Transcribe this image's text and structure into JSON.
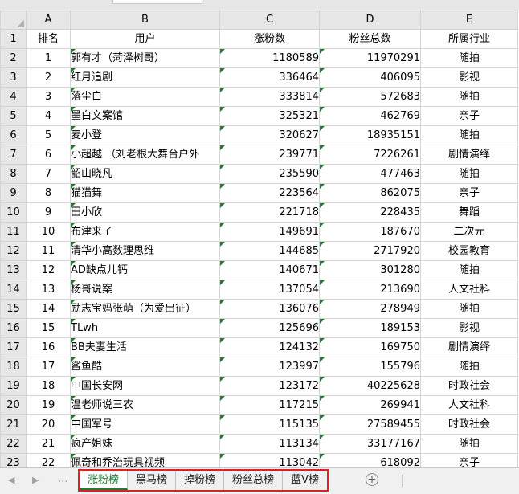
{
  "columns": [
    "A",
    "B",
    "C",
    "D",
    "E"
  ],
  "header_row": [
    "排名",
    "用户",
    "涨粉数",
    "粉丝总数",
    "所属行业"
  ],
  "rows": [
    [
      "1",
      "郭有才（菏泽树哥）",
      "1180589",
      "11970291",
      "随拍"
    ],
    [
      "2",
      "红月追剧",
      "336464",
      "406095",
      "影视"
    ],
    [
      "3",
      "落尘白",
      "333814",
      "572683",
      "随拍"
    ],
    [
      "4",
      "墨白文案馆",
      "325321",
      "462769",
      "亲子"
    ],
    [
      "5",
      "麦小登",
      "320627",
      "18935151",
      "随拍"
    ],
    [
      "6",
      "小超越 （刘老根大舞台户外",
      "239771",
      "7226261",
      "剧情演绎"
    ],
    [
      "7",
      "韶山晓凡",
      "235590",
      "477463",
      "随拍"
    ],
    [
      "8",
      "猫猫舞",
      "223564",
      "862075",
      "亲子"
    ],
    [
      "9",
      "田小欣",
      "221718",
      "228435",
      "舞蹈"
    ],
    [
      "10",
      "布津来了",
      "149691",
      "187670",
      "二次元"
    ],
    [
      "11",
      "清华小高数理思维",
      "144685",
      "2717920",
      "校园教育"
    ],
    [
      "12",
      "AD缺点儿钙",
      "140671",
      "301280",
      "随拍"
    ],
    [
      "13",
      "杨哥说案",
      "137054",
      "213690",
      "人文社科"
    ],
    [
      "14",
      "励志宝妈张萌（为爱出征）",
      "136076",
      "278949",
      "随拍"
    ],
    [
      "15",
      "TLwh",
      "125696",
      "189153",
      "影视"
    ],
    [
      "16",
      "BB夫妻生活",
      "124132",
      "169750",
      "剧情演绎"
    ],
    [
      "17",
      "鲨鱼酷",
      "123997",
      "155796",
      "随拍"
    ],
    [
      "18",
      "中国长安网",
      "123172",
      "40225628",
      "时政社会"
    ],
    [
      "19",
      "温老师说三农",
      "117215",
      "269941",
      "人文社科"
    ],
    [
      "20",
      "中国军号",
      "115135",
      "27589455",
      "时政社会"
    ],
    [
      "21",
      "疯产姐妹",
      "113134",
      "33177167",
      "随拍"
    ],
    [
      "22",
      "佩奇和乔治玩具视频",
      "113042",
      "618092",
      "亲子"
    ]
  ],
  "sheet_tabs": [
    "涨粉榜",
    "黑马榜",
    "掉粉榜",
    "粉丝总榜",
    "蓝V榜"
  ],
  "active_tab": "涨粉榜",
  "nav_left": "◀",
  "nav_right": "▶",
  "more_dots": "...",
  "add_sheet": "+",
  "colors": {
    "accent": "#1e7b34",
    "highlight_border": "#e02020",
    "header_bg": "#e6e6e6"
  }
}
